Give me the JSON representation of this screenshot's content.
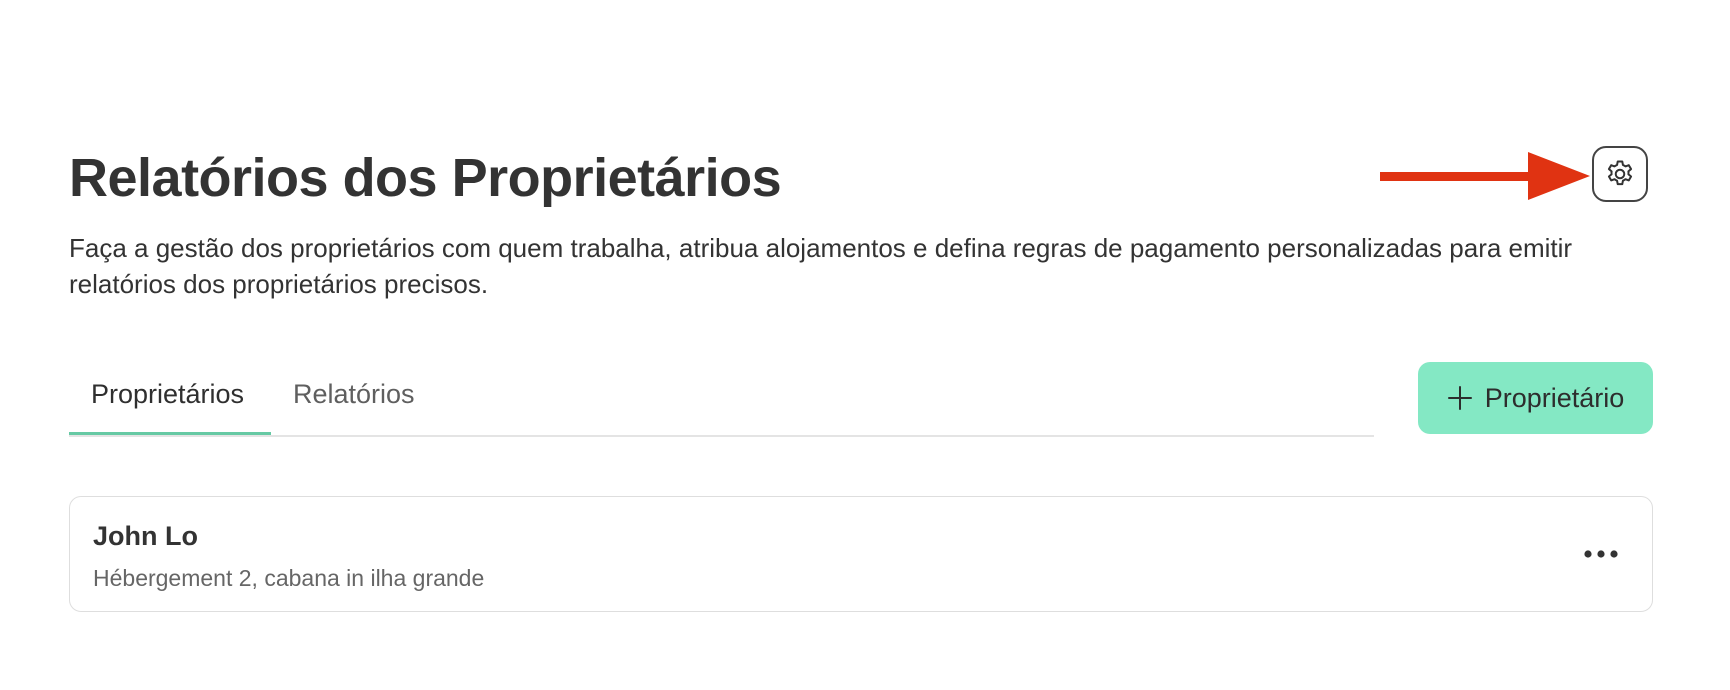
{
  "header": {
    "title": "Relatórios dos Proprietários",
    "description": "Faça a gestão dos proprietários com quem trabalha, atribua alojamentos e defina regras de pagamento personalizadas para emitir relatórios dos proprietários precisos.",
    "settings_icon": "gear-icon",
    "annotation_arrow_color": "#e03312"
  },
  "tabs": [
    {
      "label": "Proprietários",
      "active": true
    },
    {
      "label": "Relatórios",
      "active": false
    }
  ],
  "add_owner_button": {
    "icon": "plus-icon",
    "label": "Proprietário",
    "color": "#84e8c4"
  },
  "owners": [
    {
      "name": "John Lo",
      "properties": "Hébergement 2, cabana in ilha grande",
      "menu_icon": "more-horizontal-icon"
    }
  ],
  "colors": {
    "accent": "#66c9a4",
    "text": "#333333",
    "muted_text": "#666666"
  }
}
